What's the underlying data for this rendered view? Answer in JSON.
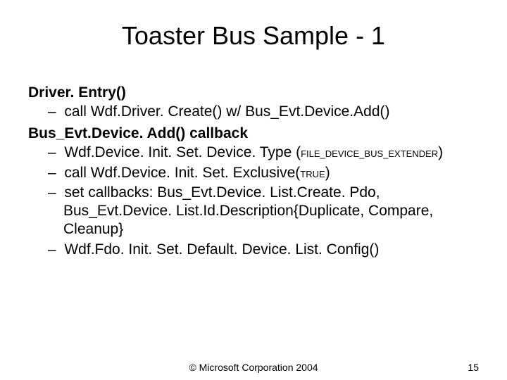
{
  "title": "Toaster Bus Sample - 1",
  "sec1": {
    "head": "Driver. Entry()",
    "b1": "call Wdf.Driver. Create() w/ Bus_Evt.Device.Add()"
  },
  "sec2": {
    "head": "Bus_Evt.Device. Add() callback",
    "b1a": "Wdf.Device. Init. Set. Device. Type (",
    "b1b": "FILE_DEVICE_BUS_EXTENDER",
    "b1c": ")",
    "b2a": "call Wdf.Device. Init. Set. Exclusive(",
    "b2b": "TRUE",
    "b2c": ")",
    "b3": "set callbacks: Bus_Evt.Device. List.Create. Pdo, Bus_Evt.Device. List.Id.Description{Duplicate, Compare, Cleanup}",
    "b4": "Wdf.Fdo. Init. Set. Default. Device. List. Config()"
  },
  "footer": {
    "copyright": "© Microsoft Corporation 2004",
    "pagenum": "15"
  }
}
